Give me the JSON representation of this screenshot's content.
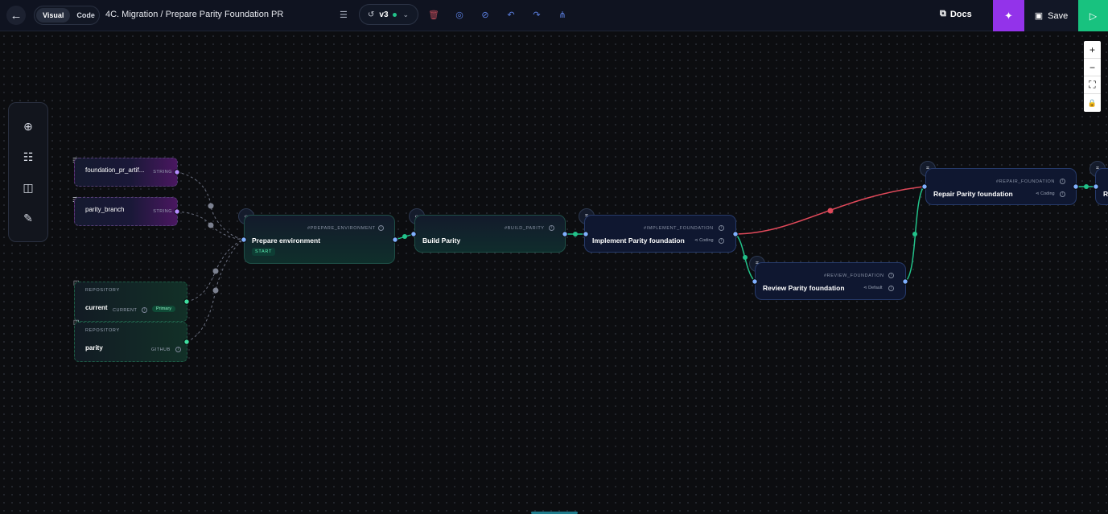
{
  "topbar": {
    "mode_tabs": [
      "Visual",
      "Code"
    ],
    "active_mode": "Visual",
    "title": "4C. Migration / Prepare Parity Foundation PR",
    "version": "v3",
    "docs_label": "Docs",
    "save_label": "Save"
  },
  "zoom_controls": [
    "+",
    "−",
    "⛶",
    "🔒"
  ],
  "variables": [
    {
      "name": "foundation_pr_artif...",
      "type": "STRING"
    },
    {
      "name": "parity_branch",
      "type": "STRING"
    }
  ],
  "repositories": [
    {
      "caption": "REPOSITORY",
      "name": "current",
      "type": "CURRENT",
      "badge": "Primary"
    },
    {
      "caption": "REPOSITORY",
      "name": "parity",
      "type": "GITHUB"
    }
  ],
  "nodes": {
    "prepare": {
      "id": "#PREPARE_ENVIRONMENT",
      "title": "Prepare environment",
      "badge": "START"
    },
    "build": {
      "id": "#BUILD_PARITY",
      "title": "Build Parity"
    },
    "implement": {
      "id": "#IMPLEMENT_FOUNDATION",
      "title": "Implement Parity foundation",
      "meta": "Coding"
    },
    "review": {
      "id": "#REVIEW_FOUNDATION",
      "title": "Review Parity foundation",
      "meta": "Default"
    },
    "repair": {
      "id": "#REPAIR_FOUNDATION",
      "title": "Repair Parity foundation",
      "meta": "Coding"
    },
    "partial": {
      "title": "R"
    }
  },
  "colors": {
    "accent_green": "#18c27f",
    "accent_purple": "#9333ea",
    "edge_red": "#e0495a",
    "edge_green": "#22c28a"
  }
}
